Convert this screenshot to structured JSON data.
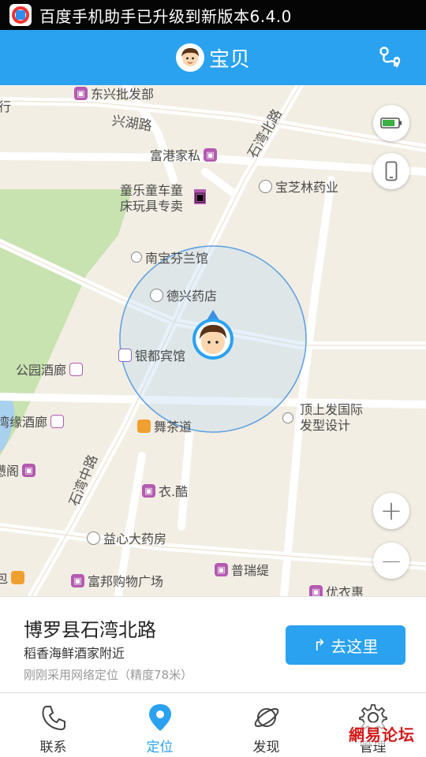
{
  "status_bar": {
    "text": "百度手机助手已升级到新版本6.4.0"
  },
  "header": {
    "title": "宝贝"
  },
  "map": {
    "roads": [
      "兴湖路",
      "石湾北路",
      "石湾中路"
    ],
    "pois": [
      {
        "label": "东兴批发部",
        "icon": "shop-icon"
      },
      {
        "label": "行",
        "icon": ""
      },
      {
        "label": "富港家私",
        "icon": "shop-icon"
      },
      {
        "label": "宝芝林药业",
        "icon": "drugstore-icon"
      },
      {
        "label": "童乐童车童",
        "label2": "床玩具专卖",
        "icon": "shop-icon"
      },
      {
        "label": "南宝芬兰馆",
        "icon": "place-icon"
      },
      {
        "label": "德兴药店",
        "icon": "drugstore-icon"
      },
      {
        "label": "银都宾馆",
        "icon": "hotel-icon"
      },
      {
        "label": "公园酒廊",
        "icon": "bar-icon"
      },
      {
        "label": "湾缘酒廊",
        "icon": "bar-icon"
      },
      {
        "label": "舞茶道",
        "icon": "cafe-icon"
      },
      {
        "label": "顶上发国际",
        "label2": "发型设计",
        "icon": "place-icon"
      },
      {
        "label": "懑阁",
        "icon": "shop-icon"
      },
      {
        "label": "衣.酷",
        "icon": "shop-icon"
      },
      {
        "label": "益心大药房",
        "icon": "drugstore-icon"
      },
      {
        "label": "包",
        "icon": "food-icon"
      },
      {
        "label": "富邦购物广场",
        "icon": "shop-icon"
      },
      {
        "label": "普瑞缇",
        "icon": "shop-icon"
      },
      {
        "label": "优衣惠",
        "icon": "shop-icon"
      }
    ],
    "battery_level": 0.8,
    "zoom_in_label": "+",
    "zoom_out_label": "—"
  },
  "location": {
    "title": "博罗县石湾北路",
    "subtitle": "稻香海鲜酒家附近",
    "note": "刚刚采用网络定位（精度78米）",
    "go_label": "去这里"
  },
  "nav": [
    {
      "label": "联系",
      "icon": "phone-icon"
    },
    {
      "label": "定位",
      "icon": "location-pin-icon"
    },
    {
      "label": "发现",
      "icon": "planet-icon"
    },
    {
      "label": "管理",
      "icon": "gear-icon"
    }
  ],
  "watermark": "網易论坛",
  "colors": {
    "accent": "#2aa2f0",
    "map_bg": "#f2eee4",
    "park": "#c8e2b0",
    "water": "#a8d0ef"
  }
}
